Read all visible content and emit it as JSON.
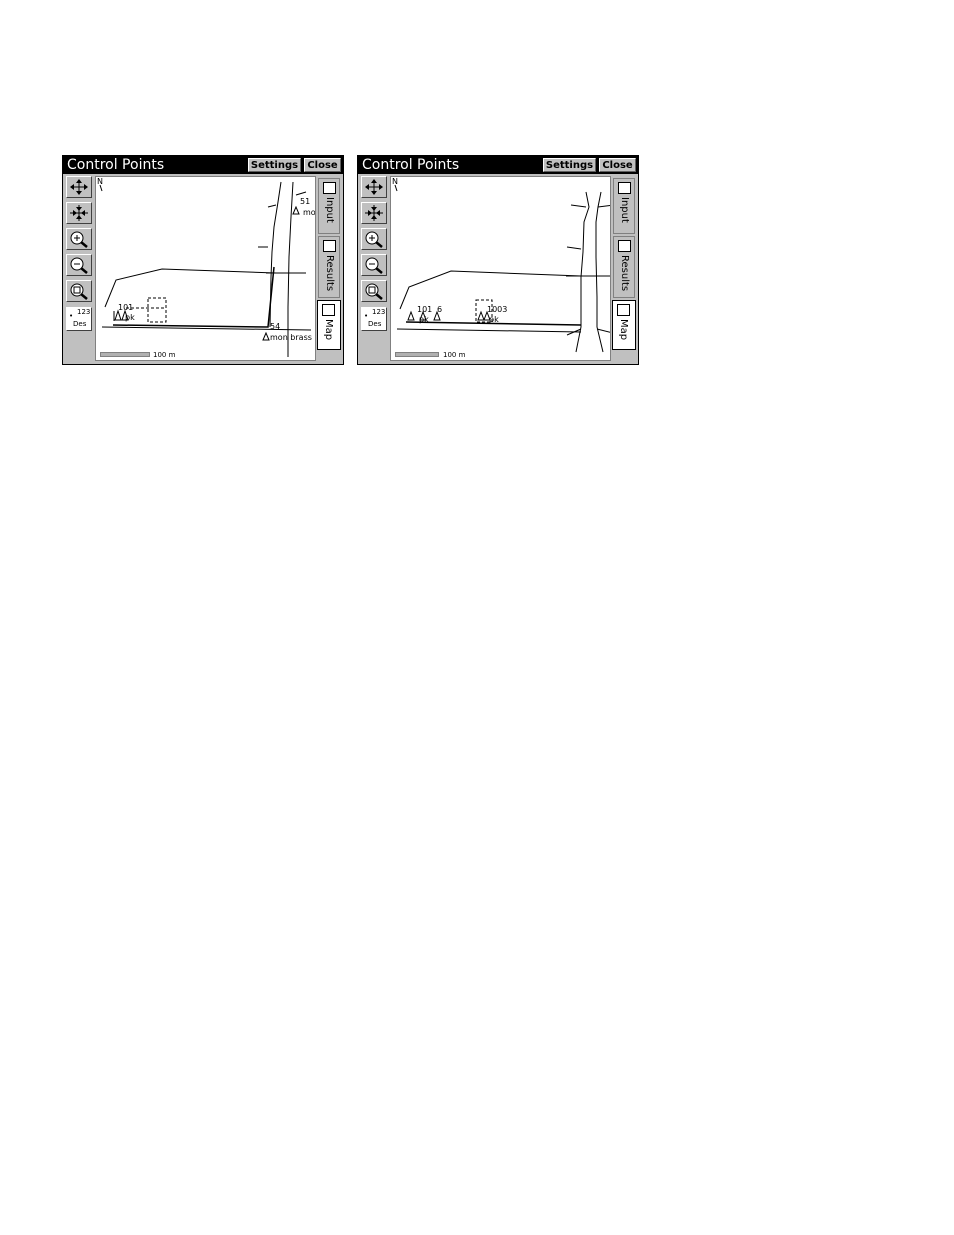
{
  "windows": [
    {
      "title": "Control Points",
      "settings_label": "Settings",
      "close_label": "Close",
      "tools": {
        "zoom_extents_label": "",
        "des_top": "123",
        "des_bottom": "Des"
      },
      "map": {
        "north_label": "N",
        "scale_label": "100 m",
        "points": [
          {
            "id": "101",
            "desc": "pk"
          },
          {
            "id": "51",
            "desc": "mon"
          },
          {
            "id": "54",
            "desc": "mon brass"
          }
        ]
      },
      "tabs": [
        {
          "label": "Input"
        },
        {
          "label": "Results"
        },
        {
          "label": "Map"
        }
      ]
    },
    {
      "title": "Control Points",
      "settings_label": "Settings",
      "close_label": "Close",
      "tools": {
        "des_top": "123",
        "des_bottom": "Des"
      },
      "map": {
        "north_label": "N",
        "scale_label": "100 m",
        "points": [
          {
            "id": "101",
            "desc": "pk"
          },
          {
            "id": "6",
            "desc": ""
          },
          {
            "id": "1003",
            "desc": "pk"
          }
        ]
      },
      "tabs": [
        {
          "label": "Input"
        },
        {
          "label": "Results"
        },
        {
          "label": "Map"
        }
      ]
    }
  ]
}
